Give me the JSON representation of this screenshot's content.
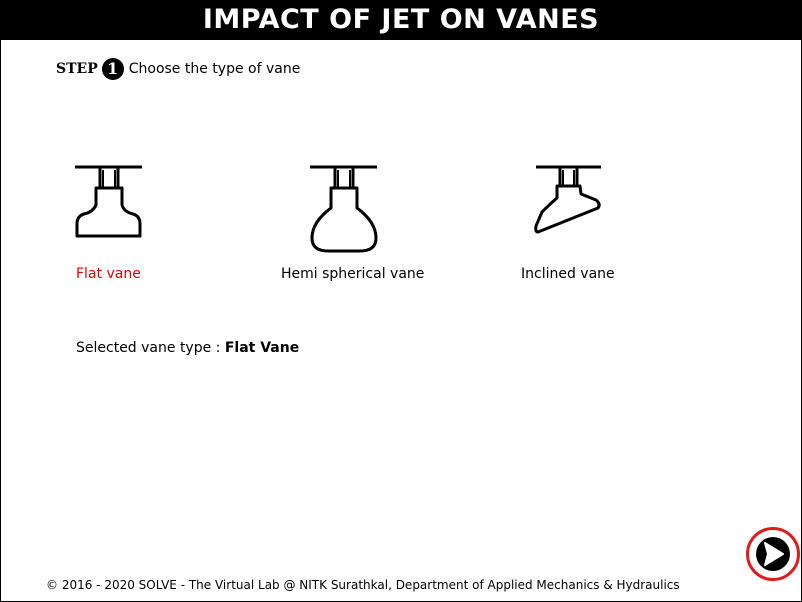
{
  "header": {
    "title": "IMPACT OF JET ON VANES"
  },
  "step": {
    "label": "STEP",
    "number": "1",
    "instruction": "Choose the type of vane"
  },
  "vanes": [
    {
      "id": "flat",
      "label": "Flat vane",
      "selected": true
    },
    {
      "id": "hemispherical",
      "label": "Hemi spherical vane",
      "selected": false
    },
    {
      "id": "inclined",
      "label": "Inclined vane",
      "selected": false
    }
  ],
  "selection": {
    "prefix": "Selected vane type :",
    "value": "Flat Vane"
  },
  "navigation": {
    "next_icon": "arrow-right-circle-icon"
  },
  "footer": {
    "text": "© 2016 - 2020 SOLVE - The Virtual Lab @ NITK Surathkal, Department of Applied Mechanics & Hydraulics"
  },
  "colors": {
    "header_bg": "#000000",
    "header_text": "#ffffff",
    "selected_label": "#e00000",
    "next_ring": "#e01b1b"
  }
}
